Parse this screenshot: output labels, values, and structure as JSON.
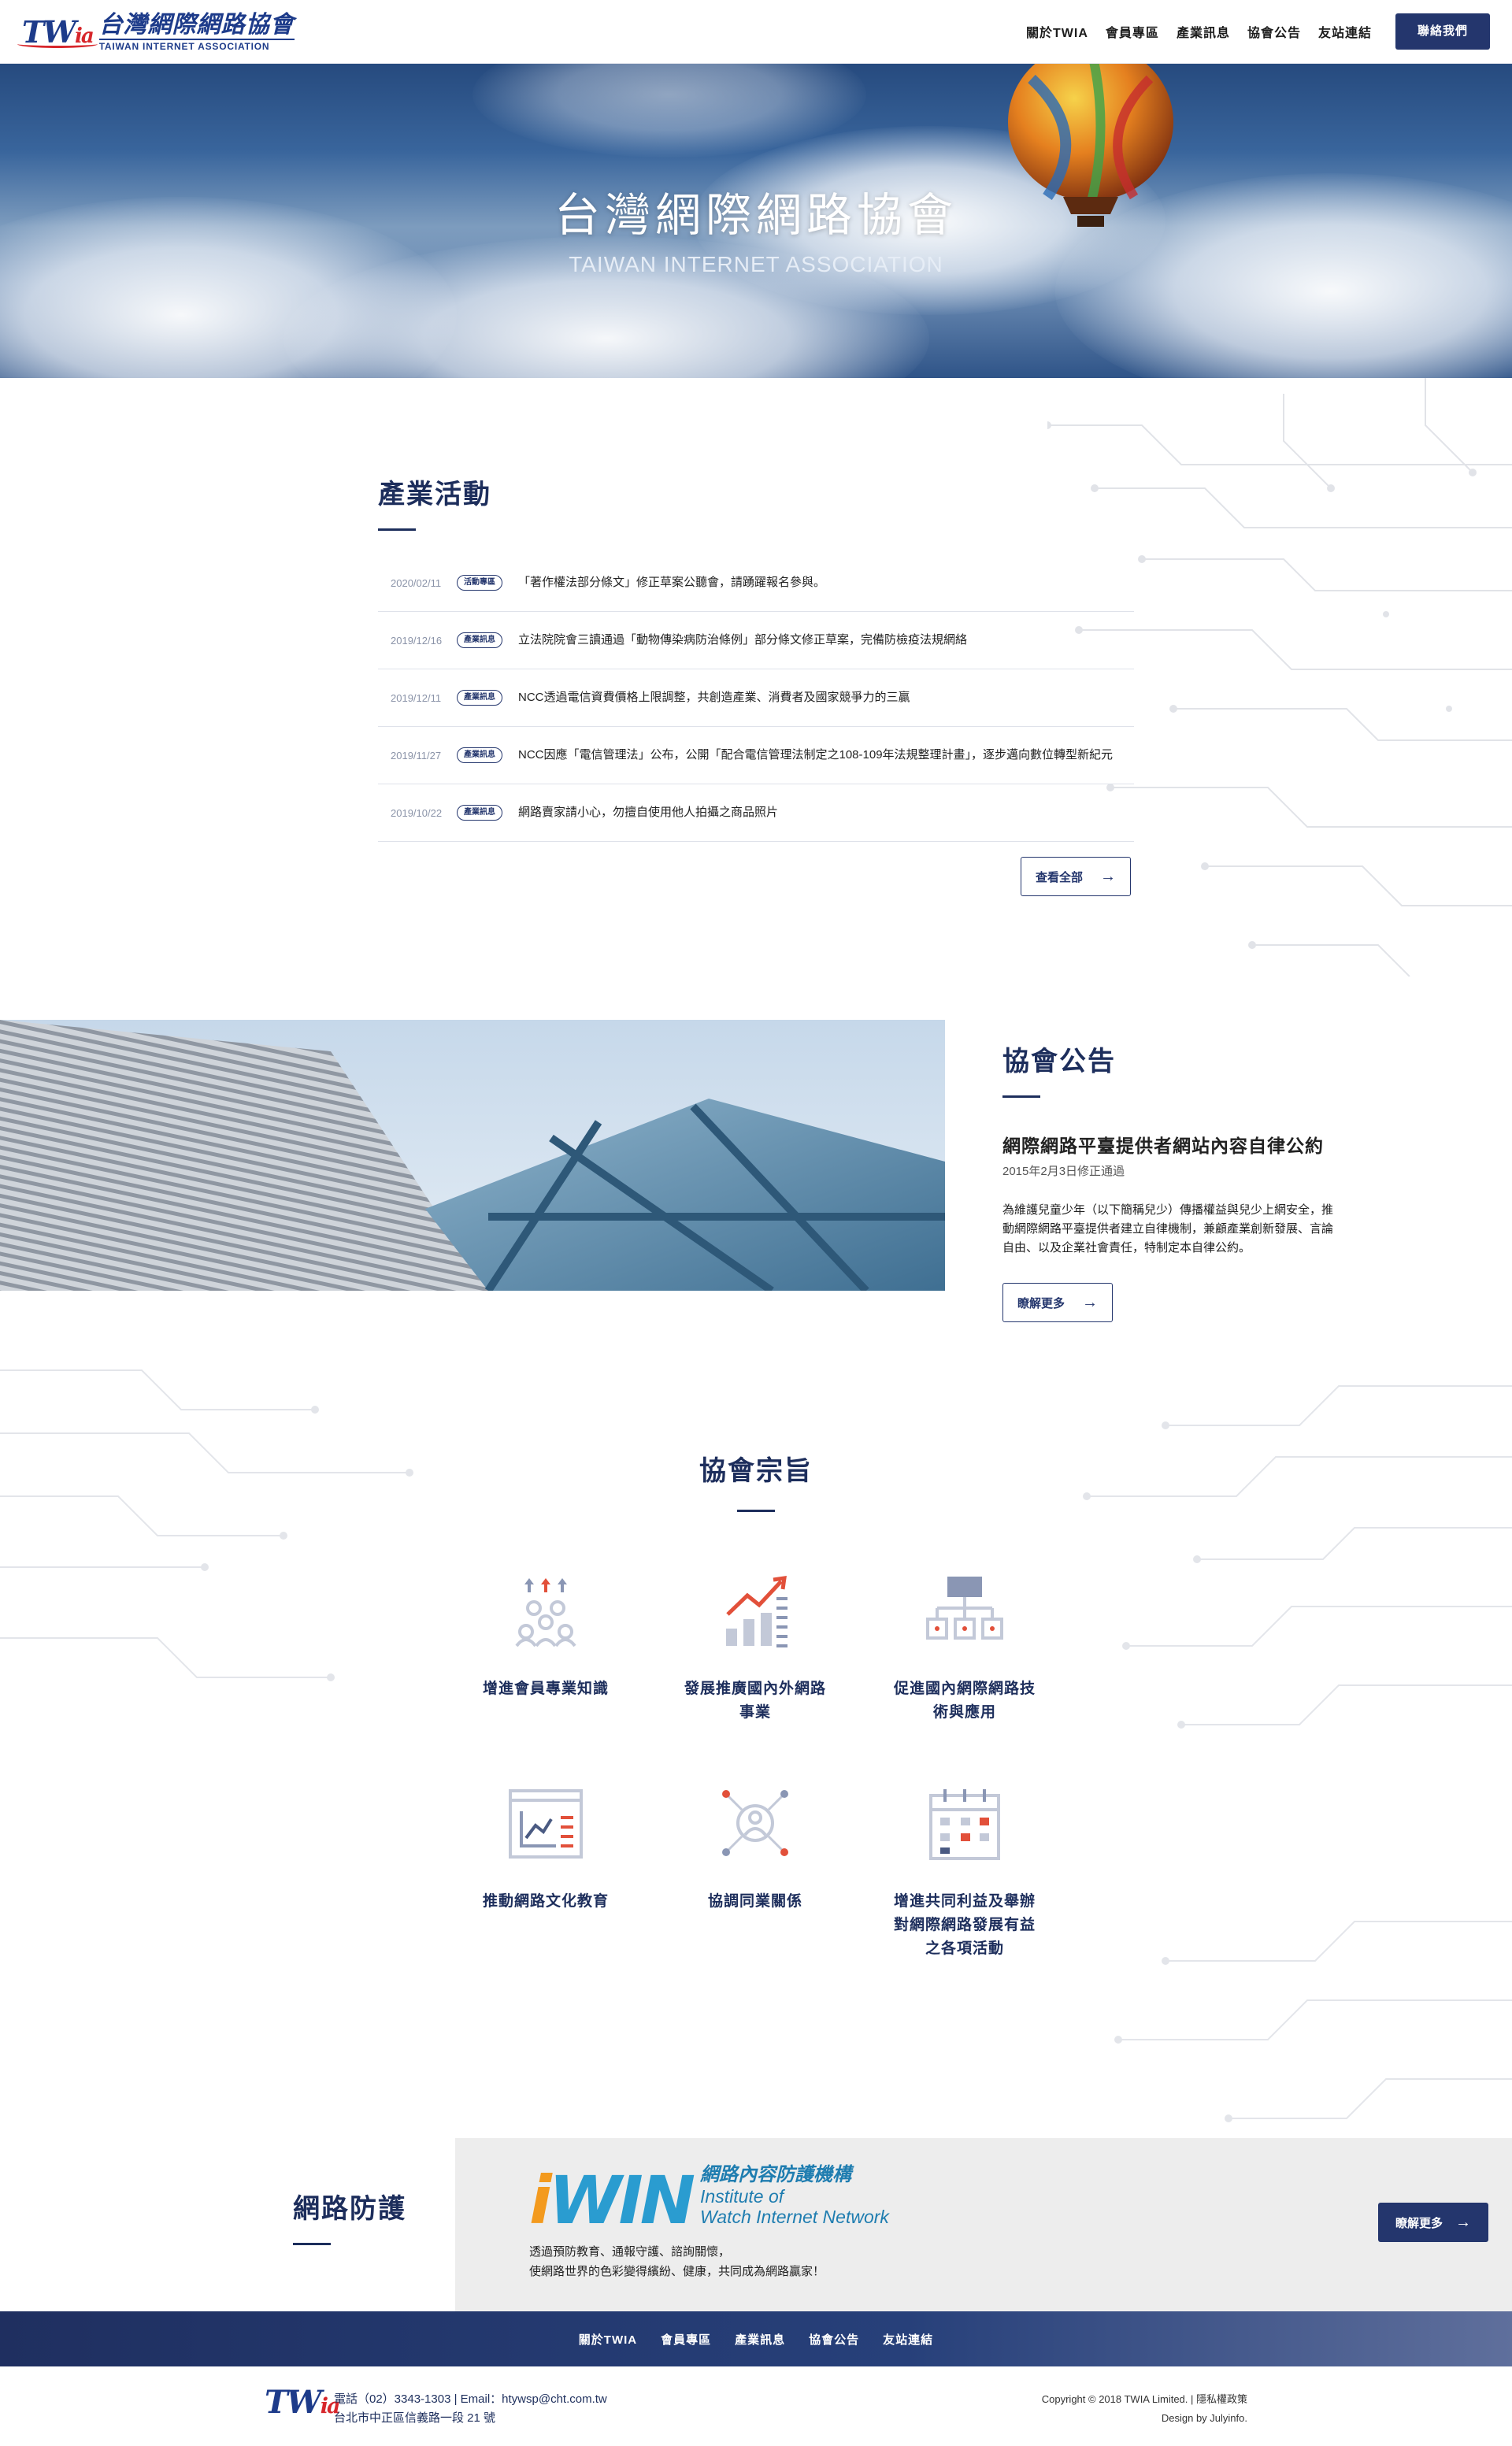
{
  "header": {
    "logo_mark": "TW",
    "logo_mark_suffix": "ia",
    "logo_zh": "台灣網際網路協會",
    "logo_en": "TAIWAN INTERNET ASSOCIATION",
    "nav": [
      "關於TWIA",
      "會員專區",
      "產業訊息",
      "協會公告",
      "友站連結"
    ],
    "contact_label": "聯絡我們"
  },
  "hero": {
    "title": "台灣網際網路協會",
    "subtitle": "TAIWAN INTERNET ASSOCIATION"
  },
  "events": {
    "title": "產業活動",
    "items": [
      {
        "date": "2020/02/11",
        "tag": "活動專區",
        "text": "「著作權法部分條文」修正草案公聽會，請踴躍報名參與。"
      },
      {
        "date": "2019/12/16",
        "tag": "產業訊息",
        "text": "立法院院會三讀通過「動物傳染病防治條例」部分條文修正草案，完備防檢疫法規網絡"
      },
      {
        "date": "2019/12/11",
        "tag": "產業訊息",
        "text": "NCC透過電信資費價格上限調整，共創造產業、消費者及國家競爭力的三贏"
      },
      {
        "date": "2019/11/27",
        "tag": "產業訊息",
        "text": "NCC因應「電信管理法」公布，公開「配合電信管理法制定之108-109年法規整理計畫」，逐步邁向數位轉型新紀元"
      },
      {
        "date": "2019/10/22",
        "tag": "產業訊息",
        "text": "網路賣家請小心，勿擅自使用他人拍攝之商品照片"
      }
    ],
    "more_label": "查看全部"
  },
  "announcement": {
    "title": "協會公告",
    "headline": "網際網路平臺提供者網站內容自律公約",
    "date": "2015年2月3日修正通過",
    "body": "為維護兒童少年（以下簡稱兒少）傳播權益與兒少上網安全，推動網際網路平臺提供者建立自律機制，兼顧產業創新發展、言論自由、以及企業社會責任，特制定本自律公約。",
    "more_label": "瞭解更多"
  },
  "mission": {
    "title": "協會宗旨",
    "items": [
      {
        "icon": "team-growth-icon",
        "label": "增進會員專業知識"
      },
      {
        "icon": "trend-chart-icon",
        "label": "發展推廣國內外網路事業"
      },
      {
        "icon": "network-hierarchy-icon",
        "label": "促進國內網際網路技術與應用"
      },
      {
        "icon": "report-chart-icon",
        "label": "推動網路文化教育"
      },
      {
        "icon": "connected-people-icon",
        "label": "協調同業關係"
      },
      {
        "icon": "calendar-icon",
        "label": "增進共同利益及舉辦對網際網路發展有益之各項活動"
      }
    ]
  },
  "protect": {
    "title": "網路防護",
    "brand_i": "i",
    "brand_win": "WIN",
    "brand_zh": "網路內容防護機構",
    "brand_en_1": "Institute of",
    "brand_en_2": "Watch Internet Network",
    "desc_1": "透過預防教育、通報守護、諮詢關懷，",
    "desc_2": "使網路世界的色彩變得繽紛、健康，共同成為網路贏家！",
    "more_label": "瞭解更多"
  },
  "footer": {
    "nav": [
      "關於TWIA",
      "會員專區",
      "產業訊息",
      "協會公告",
      "友站連結"
    ],
    "phone_line": "電話（02）3343-1303 | Email：htywsp@cht.com.tw",
    "address": "台北市中正區信義路一段 21 號",
    "copyright": "Copyright © 2018 TWIA Limited. | 隱私權政策",
    "design": "Design by Julyinfo."
  },
  "colors": {
    "primary": "#24366d",
    "accent_red": "#d7262b",
    "iwin_orange": "#f39a1e",
    "iwin_blue": "#2a9cd0"
  }
}
